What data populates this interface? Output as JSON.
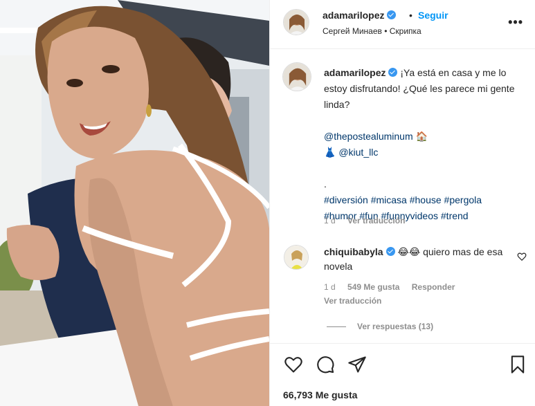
{
  "post": {
    "author": "adamarilopez",
    "follow_label": "Seguir",
    "separator": "•",
    "audio": "Сергей Минаев • Скрипка",
    "more_label": "•••"
  },
  "caption": {
    "author": "adamarilopez",
    "text_line1": "¡Ya está en casa y me lo estoy disfrutando! ¿Qué les parece mi gente linda?",
    "mention1": "@thepostealuminum",
    "mention1_emoji": "🏠",
    "mention2_emoji": "👗",
    "mention2": "@kiut_llc",
    "dot": ".",
    "hashtags_line1": "#diversión #micasa #house #pergola",
    "hashtags_line2": "#humor #fun #funnyvideos #trend",
    "time": "1 d",
    "translate": "Ver traducción"
  },
  "comment": {
    "author": "chiquibabyla",
    "text": "😂😂 quiero mas de esa novela",
    "time": "1 d",
    "likes": "549 Me gusta",
    "reply": "Responder",
    "translate": "Ver traducción",
    "replies": "Ver respuestas (13)"
  },
  "footer": {
    "likes_count": "66,793 Me gusta"
  },
  "colors": {
    "link": "#00376b",
    "follow": "#0095f6",
    "verified": "#3897f0",
    "muted": "#8e8e8e"
  }
}
